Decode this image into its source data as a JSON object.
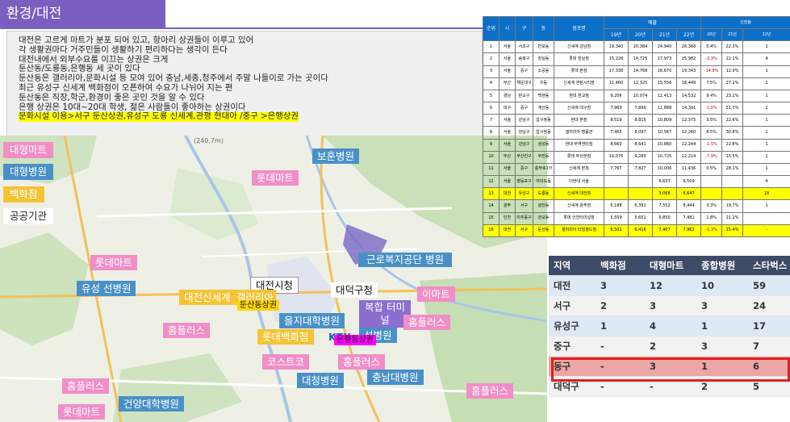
{
  "header": {
    "title": "환경/대전"
  },
  "textbox": {
    "lines": [
      "대전은 고르게 마트가 분포 되어 있고, 항아리 상권들이 이루고 있어",
      "각 생활권마다 거주민들이 생활하기 편리하다는 생각이 든다",
      "대전내에서 외부수요를 이끄는 상권은 크게",
      "둔산동/도룡동,은행동 세 곳이 있다",
      "둔산동은 갤러리아,문화시설 등 모여 있어 충남,세종,청주에서 주말 나들이로 가는 곳이다",
      "최근 유성구 신세계 백화점이 오픈하여 수요가 나뉘어 지는 편",
      "둔산동은 직장,학군,환경이 좋은 곳인 것을 알 수 있다",
      "은행 상권은 10대~20대 학생, 젊은 사람들이 좋아하는 상권이다"
    ],
    "highlight": "문화시설 이용>서구 둔산상권,유성구 도룡 신세계,관평 현대아 /중구 >은행상권"
  },
  "legend": [
    {
      "label": "대형마트",
      "color": "#f08ec8"
    },
    {
      "label": "대형병원",
      "color": "#4a90c8"
    },
    {
      "label": "백화점",
      "color": "#f5c436"
    },
    {
      "label": "공공기관",
      "color": "#ffffff"
    }
  ],
  "map": {
    "road_number": "(240.7m)",
    "places": {
      "bohun": "보훈병원",
      "lotte_top": "롯데마트",
      "lotte_left": "롯데마트",
      "welfare": "근로복지공단 병원",
      "yuseong": "유성 선병원",
      "city_hall": "대전시청",
      "daedeok_gu": "대덕구청",
      "shinsegae": "대전신세계",
      "galleria": "갤러리아",
      "emart": "이마트",
      "dunsan": "둔산동상권",
      "homeplus1": "홈플러스",
      "eulji": "을지대학병원",
      "complex": "복합 터미널",
      "homeplus2": "홈플러스",
      "lotte_dept": "롯데백화점",
      "ktx": "KTX",
      "seon": "선병원",
      "eunhaeng": "은행동상권",
      "costco": "코스트코",
      "homeplus3": "홈플러스",
      "daecheong": "대청병원",
      "chungnam": "충남대병원",
      "homeplus4": "홈플러스",
      "geonyang": "건양대학병원",
      "homeplus5": "홈플러스",
      "lotte_bottom": "롯데마트"
    }
  },
  "sales_table": {
    "headers": {
      "rank": "순위",
      "city": "시",
      "gu": "구",
      "dong": "동",
      "store": "점포명",
      "sales": "매출",
      "growth": "신장율"
    },
    "sales_years": [
      "19년",
      "20년",
      "21년",
      "22년"
    ],
    "growth_years": [
      "20년",
      "21년",
      "22년"
    ],
    "rows": [
      {
        "r": "1",
        "c": "서울",
        "g": "서초구",
        "d": "반포동",
        "s": "신세계 강남점",
        "v": [
          "19,340",
          "20,384",
          "24,940",
          "26,368"
        ],
        "p": [
          "5.4%",
          "22.3%",
          "1"
        ]
      },
      {
        "r": "2",
        "c": "서울",
        "g": "송파구",
        "d": "잠실동",
        "s": "롯데 잠실점",
        "v": [
          "15,226",
          "14,725",
          "17,973",
          "25,982"
        ],
        "p": [
          "-3.3%",
          "22.1%",
          "4"
        ]
      },
      {
        "r": "3",
        "c": "서울",
        "g": "중구",
        "d": "소공동",
        "s": "롯데 본점",
        "v": [
          "17,338",
          "14,768",
          "16,670",
          "19,343"
        ],
        "p": [
          "-14.8%",
          "12.9%",
          "1"
        ]
      },
      {
        "r": "4",
        "c": "부산",
        "g": "해운대구",
        "d": "우동",
        "s": "신세계 센텀시티점",
        "v": [
          "11,460",
          "12,325",
          "15,556",
          "18,449"
        ],
        "p": [
          "7.5%",
          "27.1%",
          "1"
        ]
      },
      {
        "r": "5",
        "c": "경남",
        "g": "판교구",
        "d": "백현동",
        "s": "현대 판교점",
        "v": [
          "9,206",
          "10,074",
          "12,413",
          "14,532"
        ],
        "p": [
          "9.4%",
          "23.2%",
          "1"
        ]
      },
      {
        "r": "6",
        "c": "대구",
        "g": "중구",
        "d": "계산동",
        "s": "신세계 대구점",
        "v": [
          "7,969",
          "7,890",
          "11,888",
          "14,391"
        ],
        "p": [
          "-1.0%",
          "51.3%",
          "2"
        ]
      },
      {
        "r": "7",
        "c": "서울",
        "g": "강남구",
        "d": "압구정동",
        "s": "현대 본점",
        "v": [
          "8,519",
          "8,815",
          "10,809",
          "12,375"
        ],
        "p": [
          "3.5%",
          "22.6%",
          "1"
        ]
      },
      {
        "r": "8",
        "c": "서울",
        "g": "강남구",
        "d": "압구정동",
        "s": "갤러리아 명품관",
        "v": [
          "7,465",
          "8,097",
          "10,567",
          "12,260"
        ],
        "p": [
          "8.5%",
          "30.8%",
          "1"
        ]
      },
      {
        "r": "9",
        "c": "서울",
        "g": "강남구",
        "d": "삼성동",
        "s": "현대 무역센터점",
        "v": [
          "8,660",
          "8,641",
          "10,860",
          "12,244"
        ],
        "p": [
          "-1.5%",
          "22.8%",
          "1"
        ]
      },
      {
        "r": "10",
        "c": "부산",
        "g": "부산진구",
        "d": "부전동",
        "s": "롯데 부산본점",
        "v": [
          "10,076",
          "9,280",
          "10,725",
          "12,214"
        ],
        "p": [
          "-7.9%",
          "15.5%",
          "1"
        ]
      },
      {
        "r": "11",
        "c": "서울",
        "g": "중구",
        "d": "충무로1가",
        "s": "신세계 본점",
        "v": [
          "7,767",
          "7,827",
          "10,006",
          "11,436"
        ],
        "p": [
          "0.5%",
          "28.1%",
          "1"
        ]
      },
      {
        "r": "12",
        "c": "서울",
        "g": "영등포구",
        "d": "여의도동",
        "s": "더현대 서울",
        "v": [
          "",
          "",
          "6,637",
          "9,509"
        ],
        "p": [
          "",
          "",
          "4"
        ]
      },
      {
        "r": "13",
        "c": "대전",
        "g": "유성구",
        "d": "도룡동",
        "s": "신세계 대전점",
        "v": [
          "",
          "",
          "3,068",
          "8,647"
        ],
        "p": [
          "",
          "",
          "18"
        ],
        "hl": true
      },
      {
        "r": "14",
        "c": "광주",
        "g": "서구",
        "d": "광천동",
        "s": "신세계 광주점",
        "v": [
          "6,188",
          "6,391",
          "7,552",
          "8,444"
        ],
        "p": [
          "3.3%",
          "19.7%",
          "1"
        ]
      },
      {
        "r": "15",
        "c": "인천",
        "g": "미추홀구",
        "d": "관교동",
        "s": "롯데 인천터미널점",
        "v": [
          "5,559",
          "5,651",
          "6,850",
          "7,481"
        ],
        "p": [
          "1.8%",
          "21.2%",
          ""
        ]
      },
      {
        "r": "16",
        "c": "대전",
        "g": "서구",
        "d": "둔산동",
        "s": "갤러리아 타임월드점",
        "v": [
          "6,501",
          "6,416",
          "7,407",
          "7,962"
        ],
        "p": [
          "-1.3%",
          "15.4%",
          "-"
        ],
        "hl": true
      }
    ]
  },
  "region_table": {
    "headers": [
      "지역",
      "백화점",
      "대형마트",
      "종합병원",
      "스타벅스"
    ],
    "rows": [
      [
        "대전",
        "3",
        "12",
        "10",
        "59"
      ],
      [
        "서구",
        "2",
        "3",
        "3",
        "24"
      ],
      [
        "유성구",
        "1",
        "4",
        "1",
        "17"
      ],
      [
        "중구",
        "-",
        "2",
        "3",
        "7"
      ],
      [
        "동구",
        "-",
        "3",
        "1",
        "6"
      ],
      [
        "대덕구",
        "-",
        "-",
        "2",
        "5"
      ]
    ],
    "highlight_row": 4
  }
}
